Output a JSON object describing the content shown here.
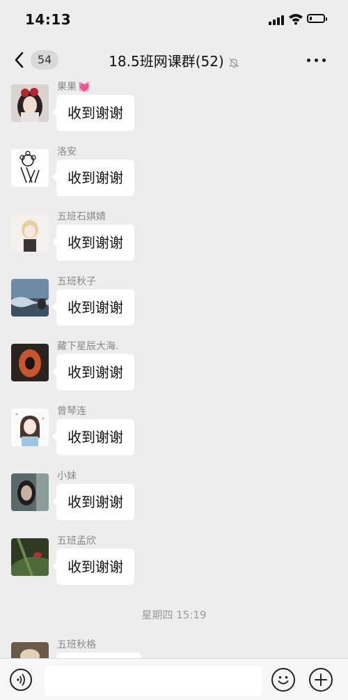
{
  "status_bar": {
    "time": "14:13",
    "signal_icon": "cellular-signal-icon",
    "wifi_icon": "wifi-icon",
    "battery_icon": "battery-icon",
    "battery_level": 0.15
  },
  "header": {
    "back_icon": "chevron-left-icon",
    "unread_count": "54",
    "title": "18.5班网课群(52)",
    "mute_icon": "bell-muted-icon",
    "more_icon": "more-dots-icon"
  },
  "messages": [
    {
      "sender": "果果",
      "sender_emoji": "💓",
      "text": "收到谢谢"
    },
    {
      "sender": "洛安",
      "text": "收到谢谢"
    },
    {
      "sender": "五班石娸婧",
      "text": "收到谢谢"
    },
    {
      "sender": "五班秋子",
      "text": "收到谢谢"
    },
    {
      "sender": "藏下星辰大海.",
      "text": "收到谢谢"
    },
    {
      "sender": "曾琴连",
      "text": "收到谢谢"
    },
    {
      "sender": "小妹",
      "text": "收到谢谢"
    },
    {
      "sender": "五班孟欣",
      "text": "收到谢谢"
    },
    {
      "sender": "五班秋格",
      "text": ""
    }
  ],
  "timestamp": "星期四 15:19",
  "input_bar": {
    "voice_icon": "voice-icon",
    "text_value": "",
    "emoji_icon": "emoji-icon",
    "plus_icon": "plus-circle-icon"
  },
  "colors": {
    "background": "#ededed",
    "bubble": "#ffffff",
    "badge": "#d9d9d9",
    "sender_name": "#888888",
    "heart": "#ff5fa2"
  }
}
